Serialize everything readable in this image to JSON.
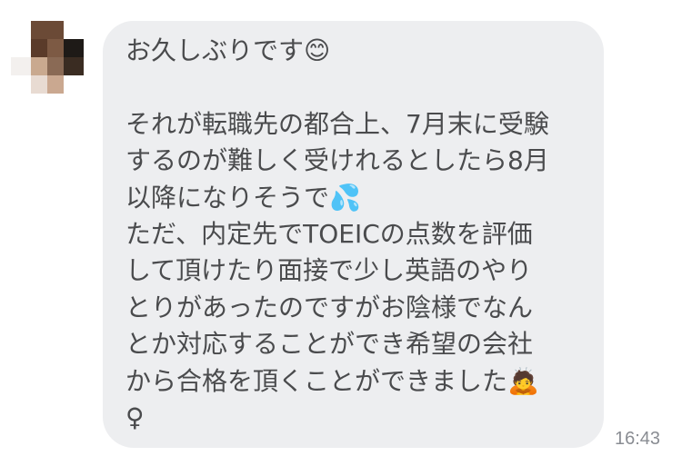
{
  "conversation": {
    "avatar_icon": "blurred-user-avatar",
    "message": {
      "text": "お久しぶりです😊\n\nそれが転職先の都合上、7月末に受験\nするのが難しく受けれるとしたら8月\n以降になりそうで💦\nただ、内定先でTOEICの点数を評価\nして頂けたり面接で少し英語のやり\nとりがあったのですがお陰様でなん\nとか対応することができ希望の会社\nから合格を頂くことができました🙇\n♀",
      "timestamp": "16:43"
    }
  },
  "colors": {
    "bubble": "#edeef0",
    "text": "#4a4b4d",
    "timestamp": "#8a8d93"
  }
}
